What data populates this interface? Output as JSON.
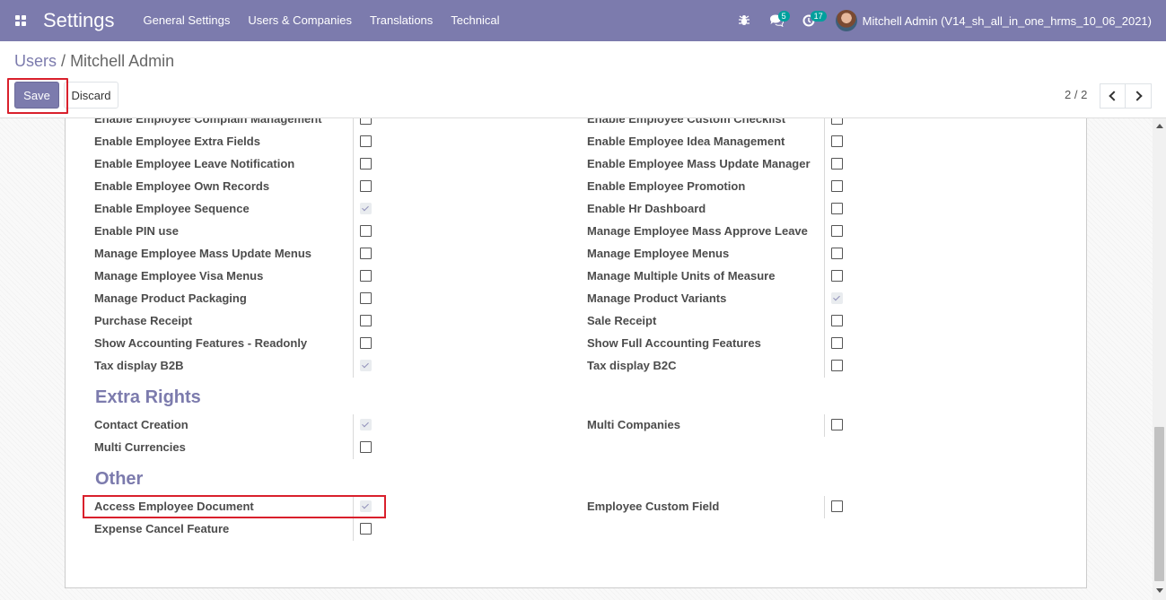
{
  "navbar": {
    "brand": "Settings",
    "menu": [
      "General Settings",
      "Users & Companies",
      "Translations",
      "Technical"
    ],
    "messages_count": "5",
    "activities_count": "17",
    "user_name": "Mitchell Admin (V14_sh_all_in_one_hrms_10_06_2021)"
  },
  "breadcrumb": {
    "parent": "Users",
    "separator": "/",
    "current": "Mitchell Admin"
  },
  "toolbar": {
    "save_label": "Save",
    "discard_label": "Discard"
  },
  "pager": {
    "value": "2 / 2"
  },
  "rights_left": [
    {
      "label": "Enable Employee Complain Management",
      "checked": false
    },
    {
      "label": "Enable Employee Extra Fields",
      "checked": false
    },
    {
      "label": "Enable Employee Leave Notification",
      "checked": false
    },
    {
      "label": "Enable Employee Own Records",
      "checked": false
    },
    {
      "label": "Enable Employee Sequence",
      "checked": true
    },
    {
      "label": "Enable PIN use",
      "checked": false
    },
    {
      "label": "Manage Employee Mass Update Menus",
      "checked": false
    },
    {
      "label": "Manage Employee Visa Menus",
      "checked": false
    },
    {
      "label": "Manage Product Packaging",
      "checked": false
    },
    {
      "label": "Purchase Receipt",
      "checked": false
    },
    {
      "label": "Show Accounting Features - Readonly",
      "checked": false
    },
    {
      "label": "Tax display B2B",
      "checked": true
    }
  ],
  "rights_right": [
    {
      "label": "Enable Employee Custom Checklist",
      "checked": false
    },
    {
      "label": "Enable Employee Idea Management",
      "checked": false
    },
    {
      "label": "Enable Employee Mass Update Manager",
      "checked": false
    },
    {
      "label": "Enable Employee Promotion",
      "checked": false
    },
    {
      "label": "Enable Hr Dashboard",
      "checked": false
    },
    {
      "label": "Manage Employee Mass Approve Leave",
      "checked": false
    },
    {
      "label": "Manage Employee Menus",
      "checked": false
    },
    {
      "label": "Manage Multiple Units of Measure",
      "checked": false
    },
    {
      "label": "Manage Product Variants",
      "checked": true
    },
    {
      "label": "Sale Receipt",
      "checked": false
    },
    {
      "label": "Show Full Accounting Features",
      "checked": false
    },
    {
      "label": "Tax display B2C",
      "checked": false
    }
  ],
  "extra_rights": {
    "title": "Extra Rights",
    "left": [
      {
        "label": "Contact Creation",
        "checked": true
      },
      {
        "label": "Multi Currencies",
        "checked": false
      }
    ],
    "right": [
      {
        "label": "Multi Companies",
        "checked": false
      }
    ]
  },
  "other": {
    "title": "Other",
    "left": [
      {
        "label": "Access Employee Document",
        "checked": true
      },
      {
        "label": "Expense Cancel Feature",
        "checked": false
      }
    ],
    "right": [
      {
        "label": "Employee Custom Field",
        "checked": false
      }
    ]
  }
}
